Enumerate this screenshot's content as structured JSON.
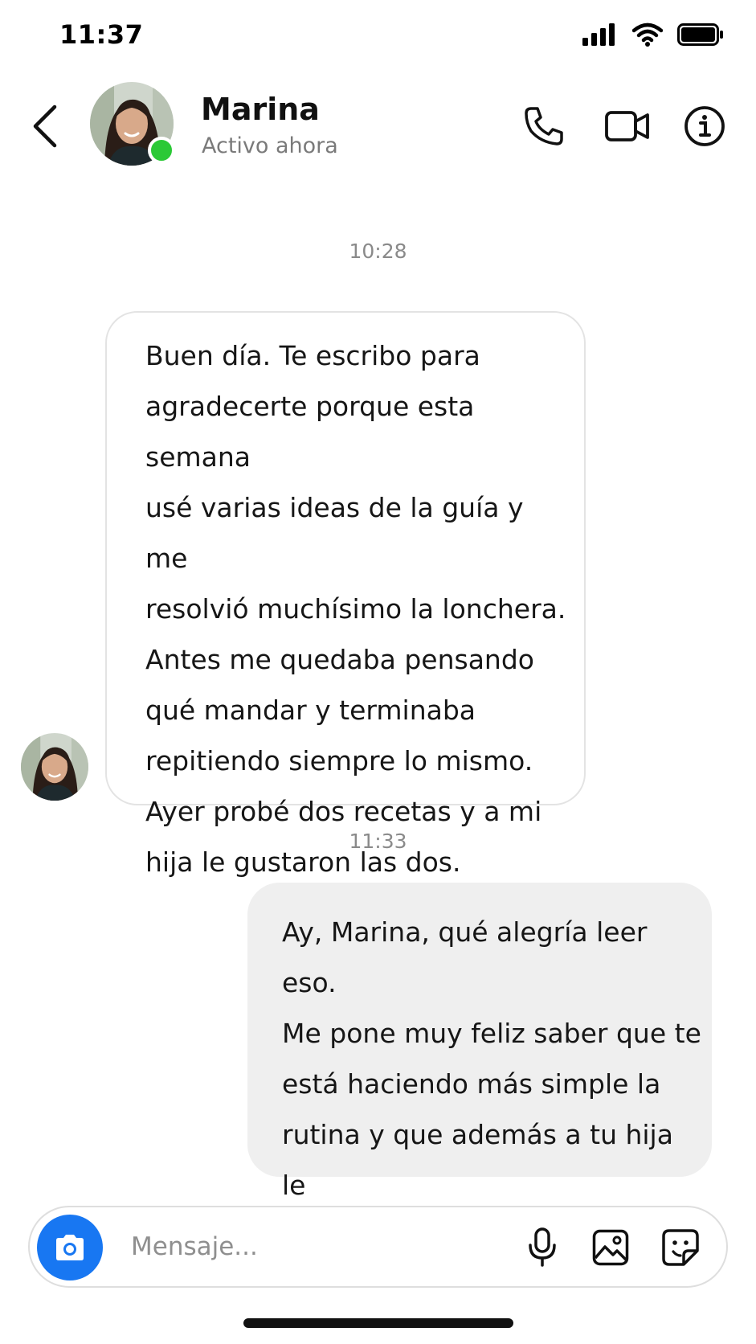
{
  "status_bar": {
    "time": "11:37"
  },
  "header": {
    "contact_name": "Marina",
    "contact_status": "Activo ahora",
    "online_color": "#2bc936",
    "icons": [
      "back-chevron-icon",
      "phone-icon",
      "video-camera-icon",
      "info-icon"
    ]
  },
  "conversation": {
    "messages": [
      {
        "timestamp": "10:28",
        "direction": "incoming",
        "text": "Buen día. Te escribo para\nagradecerte porque esta semana\nusé varias ideas de la guía y me\nresolvió muchísimo la lonchera.\nAntes me quedaba pensando\nqué mandar y terminaba\nrepitiendo siempre lo mismo.\nAyer probé dos recetas y a mi\nhija le gustaron las dos."
      },
      {
        "timestamp": "11:33",
        "direction": "outgoing",
        "text": "Ay, Marina, qué alegría leer eso.\nMe pone muy feliz saber que te\nestá haciendo más simple la\nrutina y que además a tu hija le\ngustaron las recetas ✨"
      }
    ]
  },
  "composer": {
    "placeholder": "Mensaje...",
    "value": "",
    "accent_color": "#1877f2",
    "icons": [
      "camera-icon",
      "microphone-icon",
      "image-icon",
      "sticker-icon"
    ]
  }
}
